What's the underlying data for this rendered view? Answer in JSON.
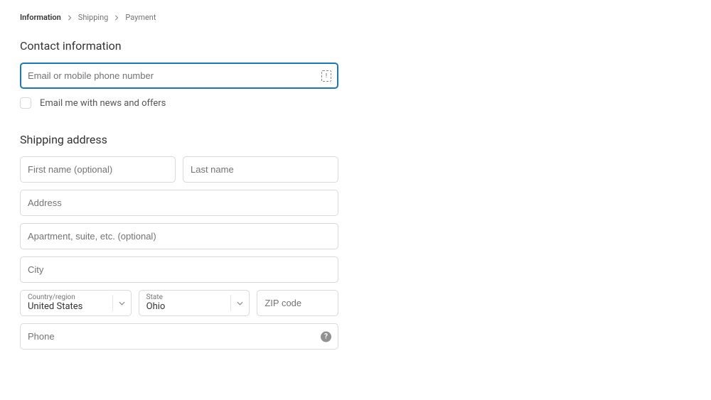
{
  "breadcrumb": {
    "steps": [
      "Information",
      "Shipping",
      "Payment"
    ],
    "active_index": 0
  },
  "contact": {
    "title": "Contact information",
    "email_placeholder": "Email or mobile phone number",
    "email_value": "",
    "news_offers_label": "Email me with news and offers"
  },
  "shipping": {
    "title": "Shipping address",
    "first_name_placeholder": "First name (optional)",
    "last_name_placeholder": "Last name",
    "address_placeholder": "Address",
    "apartment_placeholder": "Apartment, suite, etc. (optional)",
    "city_placeholder": "City",
    "country_label": "Country/region",
    "country_value": "United States",
    "state_label": "State",
    "state_value": "Ohio",
    "zip_placeholder": "ZIP code",
    "phone_placeholder": "Phone"
  }
}
